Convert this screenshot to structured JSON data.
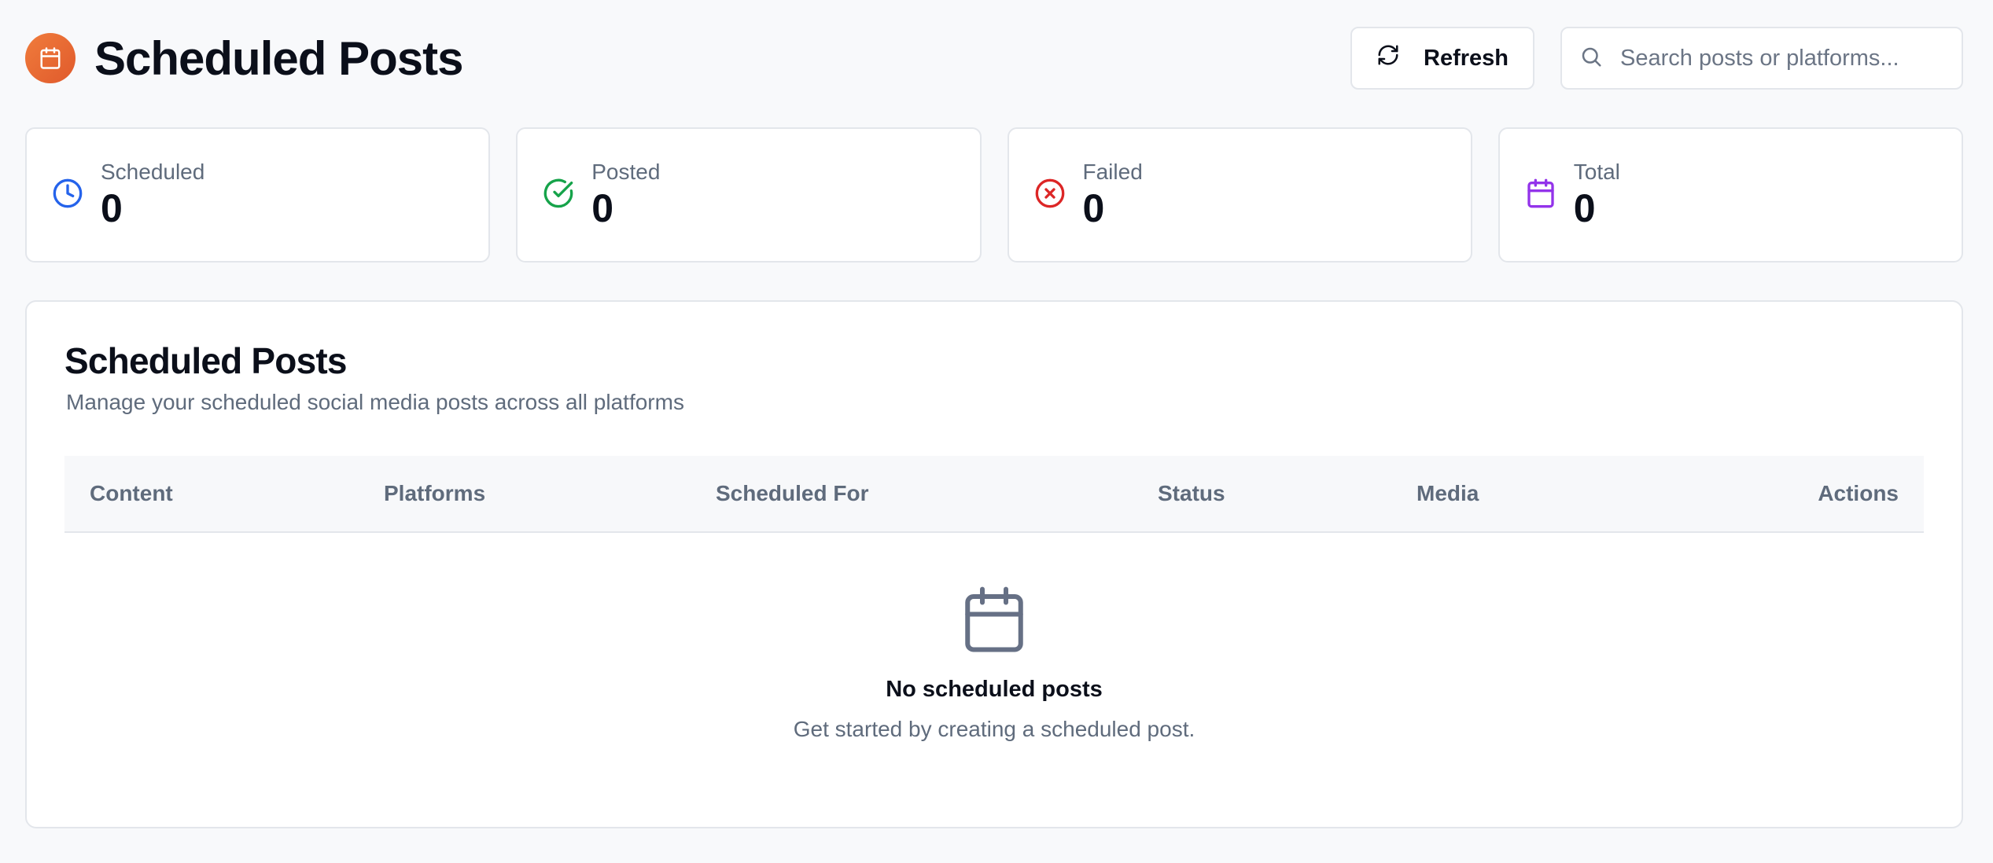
{
  "header": {
    "title": "Scheduled Posts",
    "refresh_label": "Refresh",
    "search_placeholder": "Search posts or platforms..."
  },
  "stats": [
    {
      "label": "Scheduled",
      "value": "0",
      "icon": "clock-icon",
      "color": "#2563eb"
    },
    {
      "label": "Posted",
      "value": "0",
      "icon": "check-circle-icon",
      "color": "#16a34a"
    },
    {
      "label": "Failed",
      "value": "0",
      "icon": "x-circle-icon",
      "color": "#dc2626"
    },
    {
      "label": "Total",
      "value": "0",
      "icon": "calendar-icon",
      "color": "#9333ea"
    }
  ],
  "panel": {
    "title": "Scheduled Posts",
    "subtitle": "Manage your scheduled social media posts across all platforms",
    "columns": [
      "Content",
      "Platforms",
      "Scheduled For",
      "Status",
      "Media",
      "Actions"
    ],
    "empty": {
      "title": "No scheduled posts",
      "subtitle": "Get started by creating a scheduled post."
    }
  },
  "colors": {
    "accent": "#ea6a33",
    "muted_text": "#5f6b7c",
    "border": "#e3e6eb"
  }
}
